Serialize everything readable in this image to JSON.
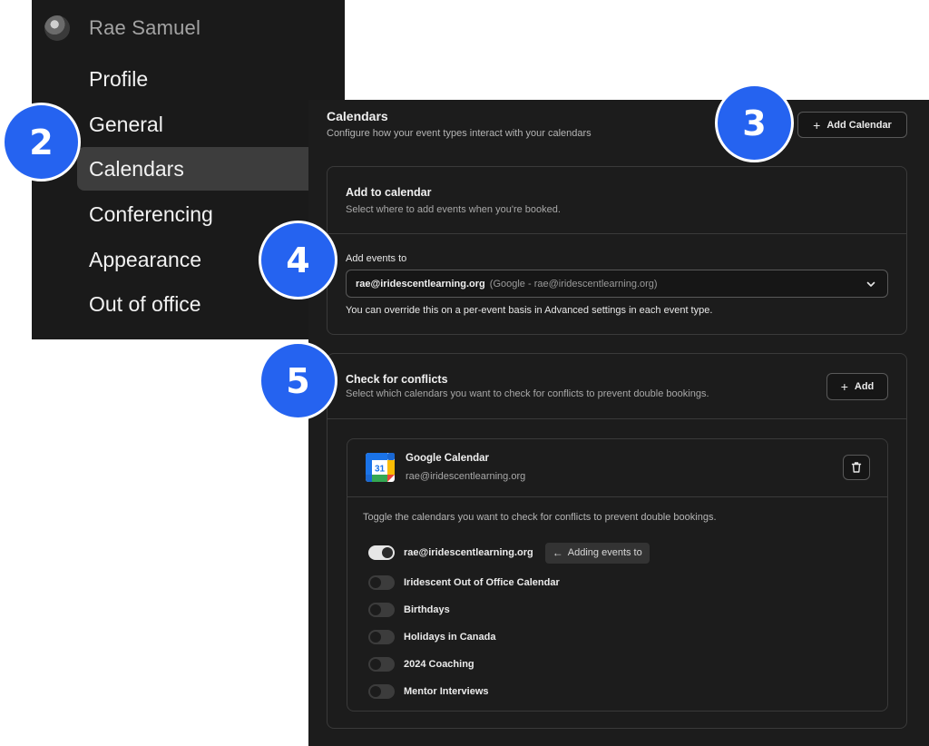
{
  "sidebar": {
    "user_name": "Rae Samuel",
    "items": [
      {
        "label": "Profile"
      },
      {
        "label": "General"
      },
      {
        "label": "Calendars",
        "active": true
      },
      {
        "label": "Conferencing"
      },
      {
        "label": "Appearance"
      },
      {
        "label": "Out of office"
      }
    ]
  },
  "header": {
    "title": "Calendars",
    "subtitle": "Configure how your event types interact with your calendars",
    "add_calendar_label": "Add Calendar"
  },
  "add_to_calendar": {
    "title": "Add to calendar",
    "subtitle": "Select where to add events when you're booked.",
    "field_label": "Add events to",
    "selected_value": "rae@iridescentlearning.org",
    "selected_detail": "(Google - rae@iridescentlearning.org)",
    "hint": "You can override this on a per-event basis in Advanced settings in each event type."
  },
  "conflicts": {
    "title": "Check for conflicts",
    "subtitle": "Select which calendars you want to check for conflicts to prevent double bookings.",
    "add_label": "Add",
    "provider": {
      "name": "Google Calendar",
      "email": "rae@iridescentlearning.org",
      "icon_day": "31"
    },
    "toggle_hint": "Toggle the calendars you want to check for conflicts to prevent double bookings.",
    "adding_label": "Adding events to",
    "calendars": [
      {
        "label": "rae@iridescentlearning.org",
        "enabled": true
      },
      {
        "label": "Iridescent Out of Office Calendar",
        "enabled": false
      },
      {
        "label": "Birthdays",
        "enabled": false
      },
      {
        "label": "Holidays in Canada",
        "enabled": false
      },
      {
        "label": "2024 Coaching",
        "enabled": false
      },
      {
        "label": "Mentor Interviews",
        "enabled": false
      }
    ]
  },
  "markers": [
    "2",
    "3",
    "4",
    "5"
  ],
  "colors": {
    "marker_blue": "#2563f0",
    "panel_bg": "#1c1c1c",
    "sidebar_bg": "#1a1a1a",
    "active_item_bg": "#3d3d3d"
  }
}
